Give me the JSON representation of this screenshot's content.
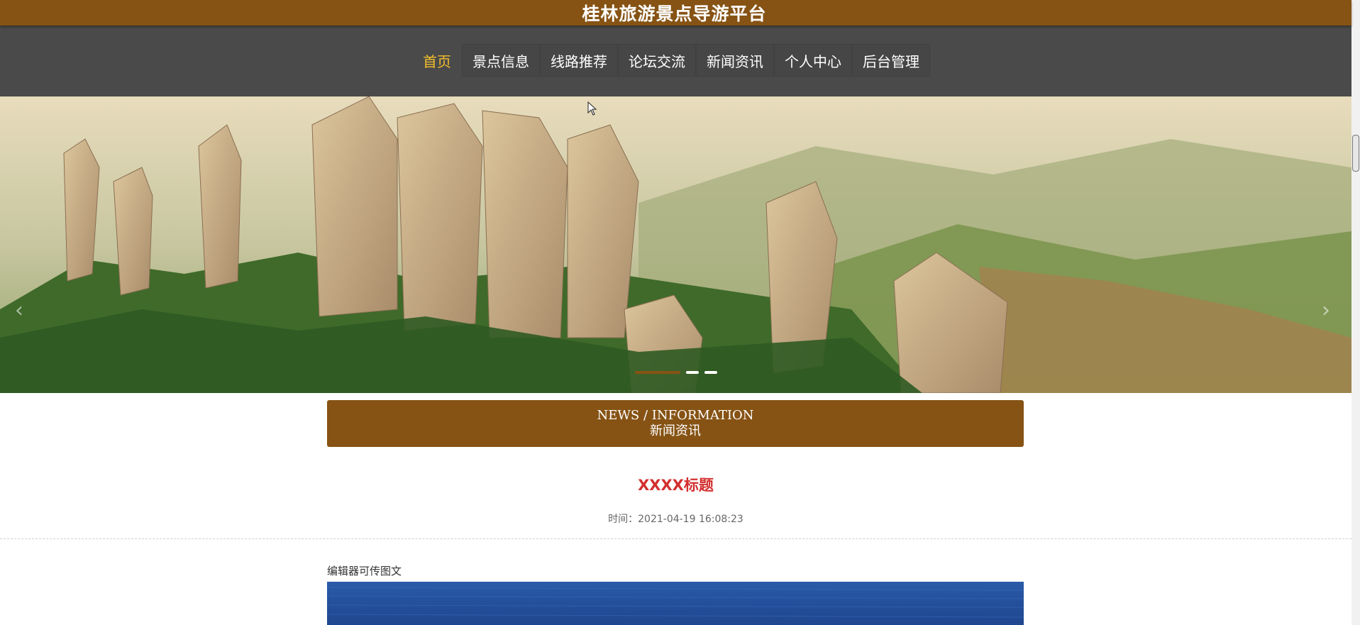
{
  "header": {
    "title": "桂林旅游景点导游平台"
  },
  "nav": {
    "items": [
      {
        "label": "首页",
        "active": true
      },
      {
        "label": "景点信息",
        "active": false
      },
      {
        "label": "线路推荐",
        "active": false
      },
      {
        "label": "论坛交流",
        "active": false
      },
      {
        "label": "新闻资讯",
        "active": false
      },
      {
        "label": "个人中心",
        "active": false
      },
      {
        "label": "后台管理",
        "active": false
      }
    ]
  },
  "carousel": {
    "prev_icon": "chevron-left-icon",
    "next_icon": "chevron-right-icon",
    "indicator_count": 3,
    "active_index": 0
  },
  "news_section": {
    "heading_en": "NEWS / INFORMATION",
    "heading_cn": "新闻资讯"
  },
  "article": {
    "title": "XXXX标题",
    "time": "时间：2021-04-19 16:08:23",
    "body_text": "编辑器可传图文"
  },
  "colors": {
    "brand": "#865314",
    "nav_bg": "#4a4a4a",
    "nav_active": "#f3bf2c",
    "title_red": "#d32f2f"
  }
}
